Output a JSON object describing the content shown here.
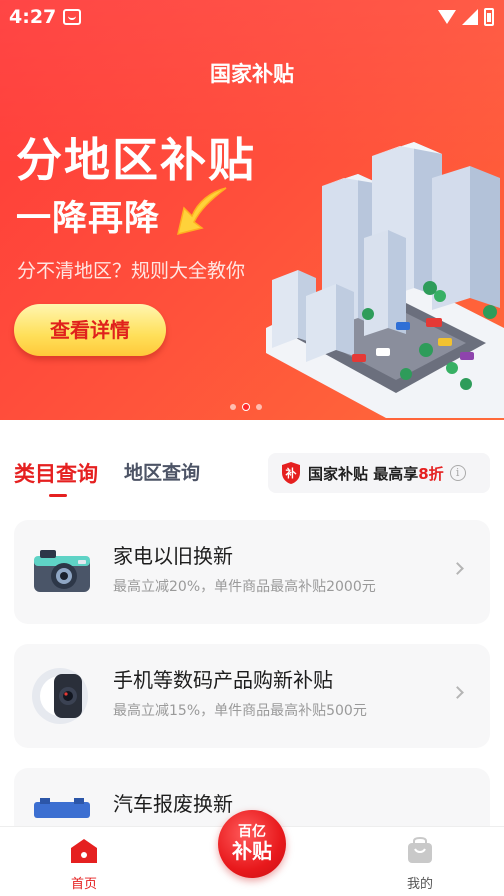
{
  "status_bar": {
    "time": "4:27"
  },
  "header": {
    "title": "国家补贴"
  },
  "banner": {
    "headline": "分地区补贴",
    "subheadline": "一降再降",
    "description": "分不清地区？规则大全教你",
    "cta_label": "查看详情",
    "carousel_total": 3,
    "carousel_active": 2
  },
  "tabs": [
    {
      "label": "类目查询",
      "active": true
    },
    {
      "label": "地区查询",
      "active": false
    }
  ],
  "promo_badge": {
    "shield_text": "补",
    "text": "国家补贴 最高享",
    "discount": "8折"
  },
  "categories": [
    {
      "title": "家电以旧换新",
      "subtitle": "最高立减20%，单件商品最高补贴2000元",
      "icon": "camera-icon"
    },
    {
      "title": "手机等数码产品购新补贴",
      "subtitle": "最高立减15%，单件商品最高补贴500元",
      "icon": "phone-camera-icon"
    },
    {
      "title": "汽车报废换新",
      "subtitle": "",
      "icon": "car-icon"
    }
  ],
  "bottom_nav": {
    "home_label": "首页",
    "center_line1": "百亿",
    "center_line2": "补贴",
    "mine_label": "我的"
  },
  "colors": {
    "brand_red": "#e52020",
    "banner_start": "#ff3a3a",
    "banner_end": "#ff6a3a",
    "cta_yellow": "#ffe05a"
  }
}
